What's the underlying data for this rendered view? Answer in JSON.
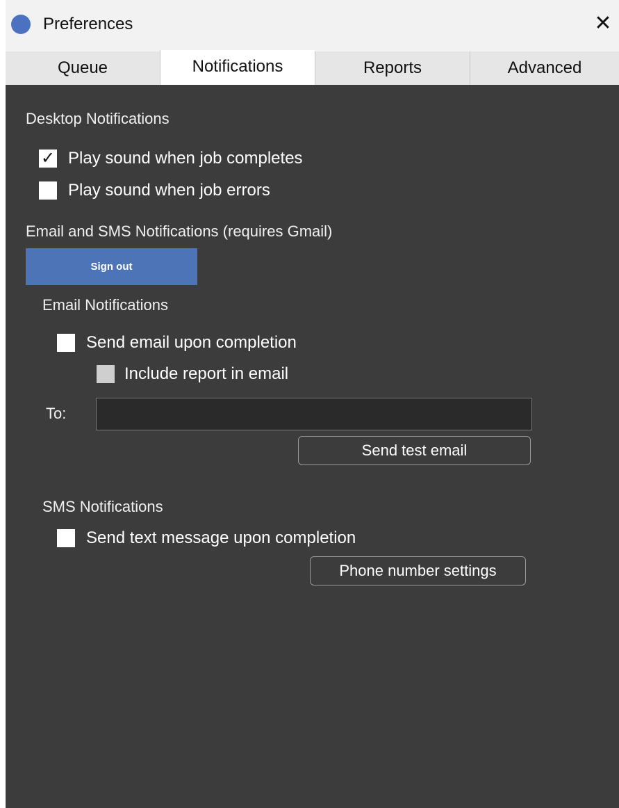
{
  "window": {
    "title": "Preferences",
    "close_glyph": "✕",
    "app_icon": "app-logo-circle",
    "colors": {
      "content_bg": "#3c3c3c",
      "accent_button": "#4d74b7",
      "app_icon": "#4a72c0"
    }
  },
  "tabs": [
    {
      "label": "Queue",
      "active": false
    },
    {
      "label": "Notifications",
      "active": true
    },
    {
      "label": "Reports",
      "active": false
    },
    {
      "label": "Advanced",
      "active": false
    }
  ],
  "desktop": {
    "heading": "Desktop Notifications",
    "play_complete": {
      "label": "Play sound when job completes",
      "checked": true,
      "glyph": "✓"
    },
    "play_errors": {
      "label": "Play sound when job errors",
      "checked": false
    }
  },
  "email_sms": {
    "heading": "Email and SMS Notifications (requires Gmail)",
    "sign_out_label": "Sign out"
  },
  "email": {
    "heading": "Email Notifications",
    "send_on_completion": {
      "label": "Send email upon completion",
      "checked": false
    },
    "include_report": {
      "label": "Include report in email",
      "checked": false,
      "disabled": true
    },
    "to_label": "To:",
    "to_value": "",
    "test_button_label": "Send test email"
  },
  "sms": {
    "heading": "SMS Notifications",
    "send_text": {
      "label": "Send text message upon completion",
      "checked": false
    },
    "phone_settings_label": "Phone number settings"
  }
}
